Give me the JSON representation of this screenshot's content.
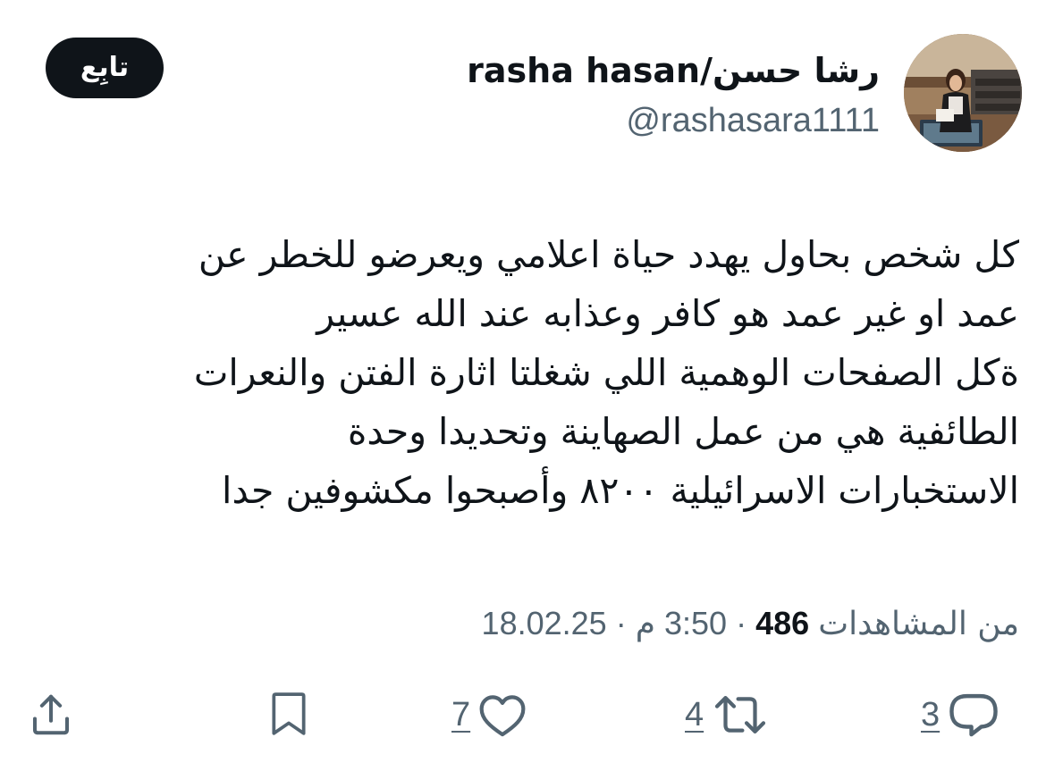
{
  "author": {
    "display_name": "rasha hasan/رشا حسن",
    "handle": "@rashasara1111"
  },
  "follow_button": {
    "label": "تابِع"
  },
  "tweet": {
    "lines": [
      "كل شخص بحاول يهدد حياة اعلامي ويعرضو للخطر عن",
      "عمد او غير عمد هو كافر وعذابه عند الله عسير",
      "ةكل الصفحات الوهمية اللي شغلتا اثارة الفتن والنعرات",
      "الطائفية هي من عمل الصهاينة وتحديدا وحدة",
      "الاستخبارات الاسرائيلية ٨٢٠٠ وأصبحوا مكشوفين جدا"
    ]
  },
  "meta": {
    "date": "18.02.25",
    "separator": "·",
    "time": "3:50 م",
    "views_count": "486",
    "views_label": "من المشاهدات"
  },
  "actions": {
    "reply": {
      "count": "3",
      "icon": "reply-icon"
    },
    "repost": {
      "count": "4",
      "icon": "repost-icon"
    },
    "like": {
      "count": "7",
      "icon": "heart-icon"
    },
    "bookmark": {
      "icon": "bookmark-icon"
    },
    "share": {
      "icon": "share-icon"
    }
  },
  "colors": {
    "text_primary": "#0f1419",
    "text_secondary": "#536471",
    "button_bg": "#0f1419",
    "button_text": "#ffffff"
  }
}
